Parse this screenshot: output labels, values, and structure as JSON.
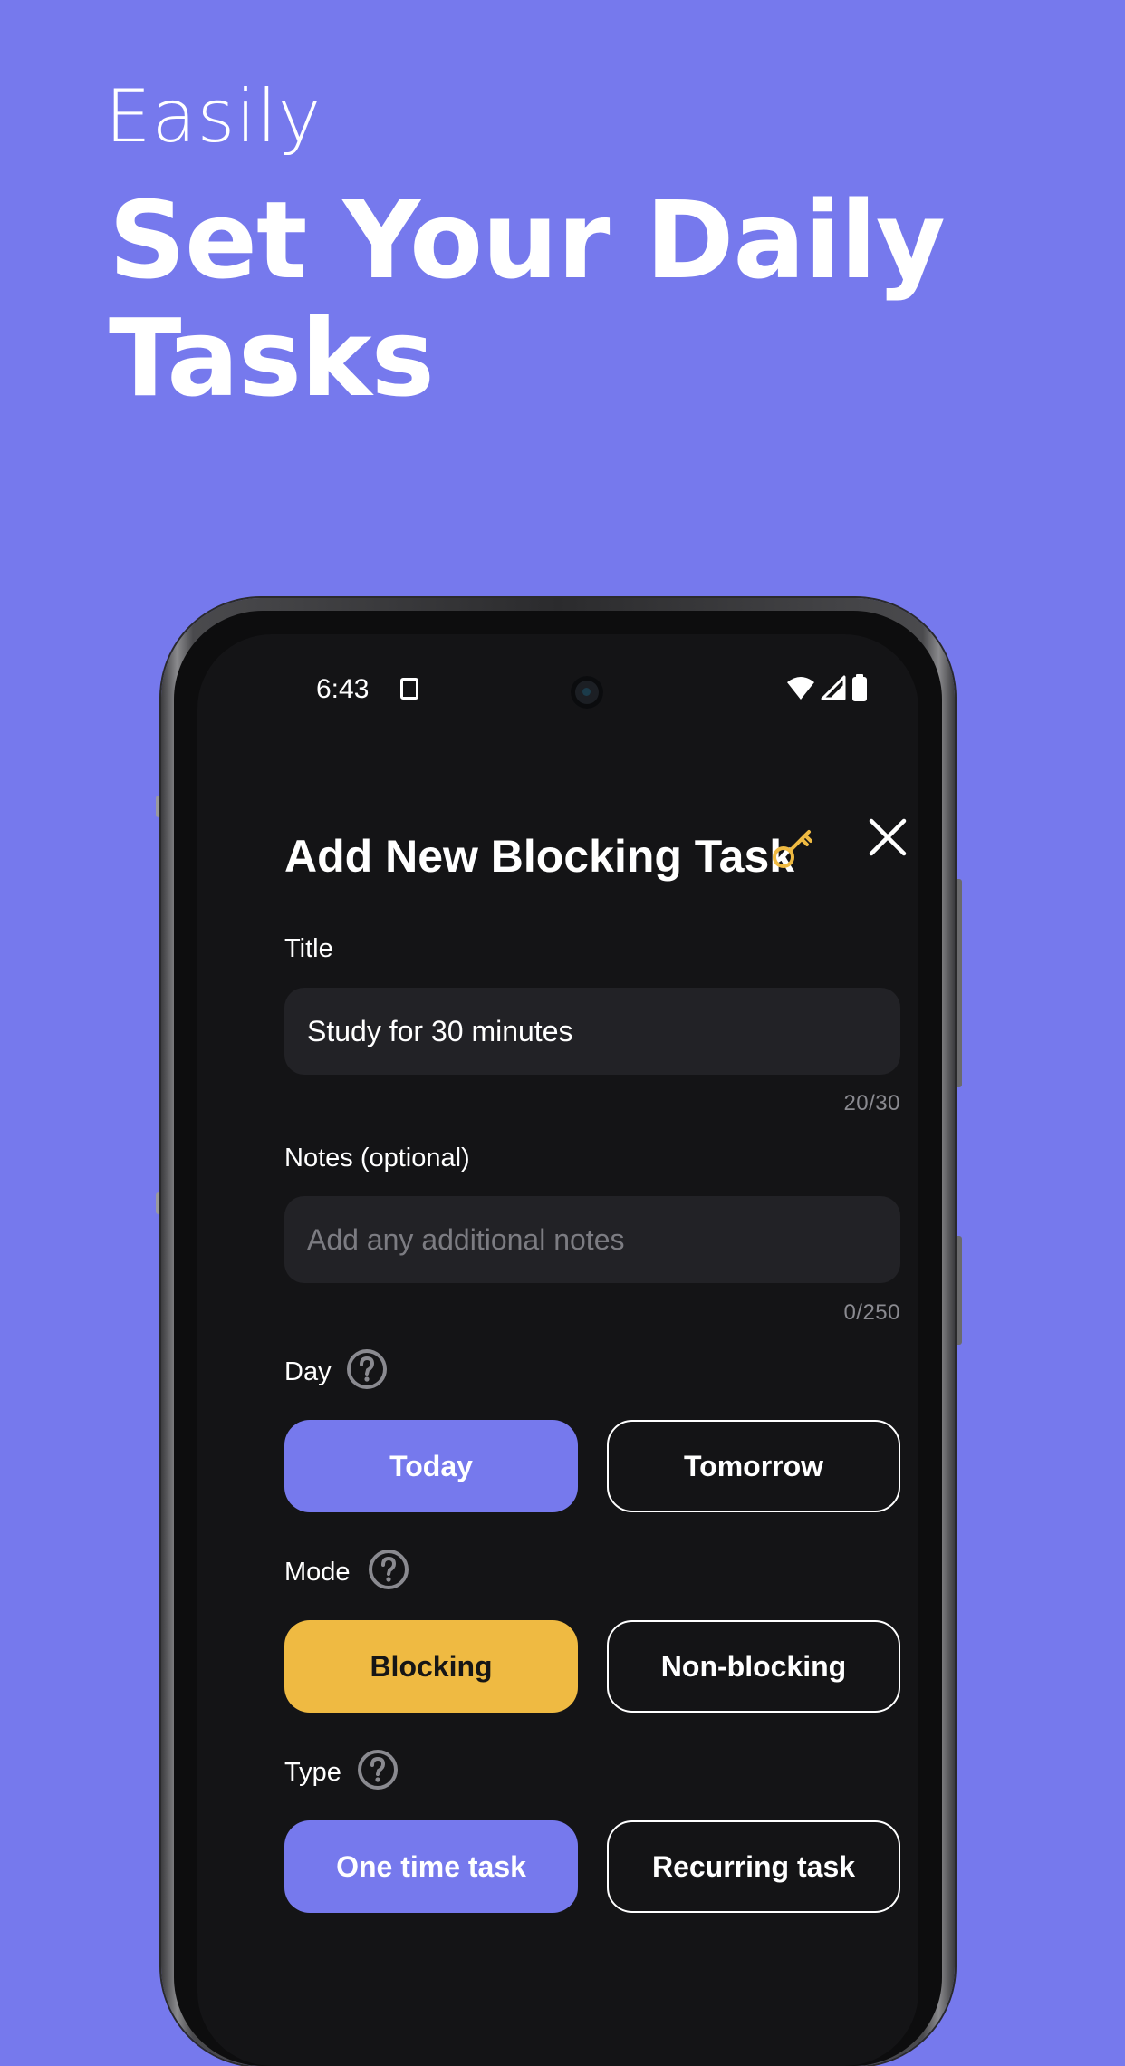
{
  "hero": {
    "subtitle": "Easily",
    "title": "Set Your Daily Tasks"
  },
  "status_bar": {
    "time": "6:43",
    "icons": [
      "sd-card-icon",
      "wifi-icon",
      "cellular-signal-icon",
      "battery-icon"
    ]
  },
  "dialog": {
    "title": "Add New Blocking Task",
    "title_icon": "key-icon",
    "close_icon": "close-icon",
    "title_field": {
      "label": "Title",
      "value": "Study for 30 minutes",
      "counter": "20/30"
    },
    "notes_field": {
      "label": "Notes (optional)",
      "placeholder": "Add any additional notes",
      "counter": "0/250"
    },
    "day": {
      "label": "Day",
      "options": [
        "Today",
        "Tomorrow"
      ],
      "selected": "Today"
    },
    "mode": {
      "label": "Mode",
      "options": [
        "Blocking",
        "Non-blocking"
      ],
      "selected": "Blocking"
    },
    "type": {
      "label": "Type",
      "options": [
        "One time task",
        "Recurring task"
      ],
      "selected": "One time task"
    }
  },
  "colors": {
    "background": "#7679ED",
    "accent_purple": "#7679ED",
    "accent_yellow": "#EFBA42",
    "screen_bg": "#141416",
    "field_bg": "#222226"
  }
}
